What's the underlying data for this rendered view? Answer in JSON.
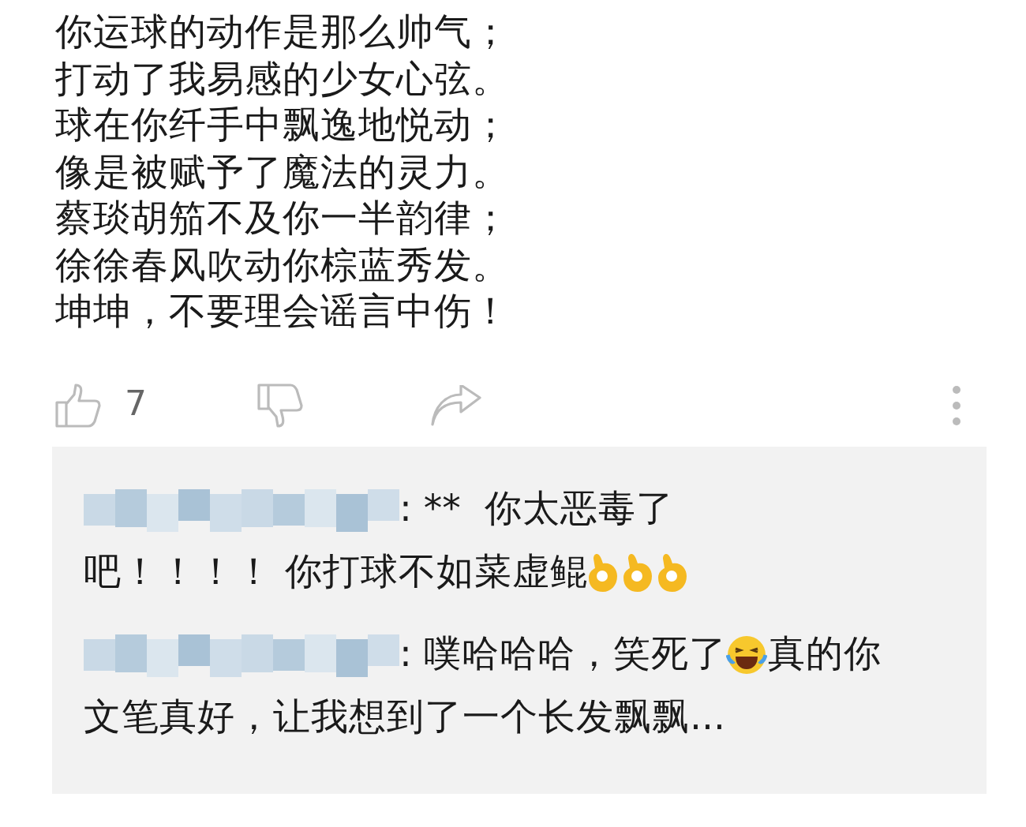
{
  "post": {
    "lines": [
      "你运球的动作是那么帅气；",
      "打动了我易感的少女心弦。",
      "球在你纤手中飘逸地悦动；",
      "像是被赋予了魔法的灵力。",
      "蔡琰胡笳不及你一半韵律；",
      "徐徐春风吹动你棕蓝秀发。",
      "坤坤，不要理会谣言中伤！"
    ]
  },
  "actions": {
    "like_count": "7"
  },
  "replies": [
    {
      "lines": [
        [
          {
            "kind": "name"
          },
          {
            "kind": "text",
            "text": ": **  你太恶毒了"
          }
        ],
        [
          {
            "kind": "text",
            "text": "吧！！！！ 你打球不如菜虚鲲"
          },
          {
            "kind": "ok"
          },
          {
            "kind": "ok"
          },
          {
            "kind": "ok"
          }
        ]
      ]
    },
    {
      "lines": [
        [
          {
            "kind": "name"
          },
          {
            "kind": "text",
            "text": ": 噗哈哈哈，笑死了"
          },
          {
            "kind": "laugh"
          },
          {
            "kind": "text",
            "text": "真的你"
          }
        ],
        [
          {
            "kind": "text",
            "text": "文笔真好，让我想到了一个长发飘飘..."
          }
        ]
      ]
    }
  ]
}
